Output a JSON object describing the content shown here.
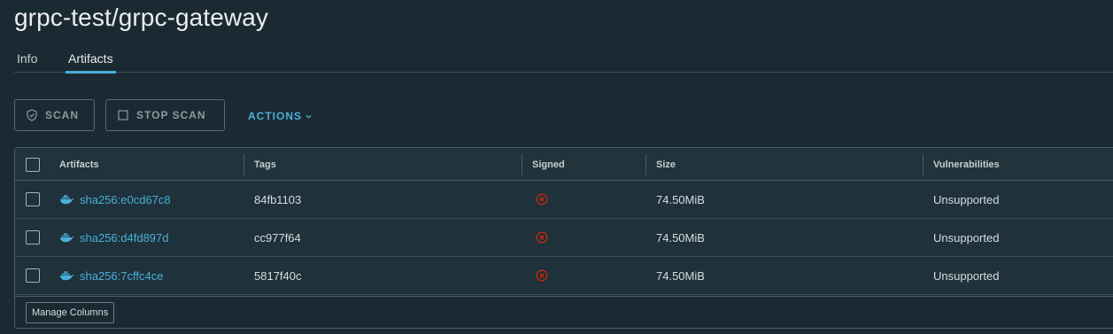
{
  "page": {
    "title": "grpc-test/grpc-gateway"
  },
  "tabs": [
    {
      "label": "Info"
    },
    {
      "label": "Artifacts"
    }
  ],
  "toolbar": {
    "scan_label": "SCAN",
    "stop_scan_label": "STOP SCAN",
    "actions_label": "ACTIONS"
  },
  "grid": {
    "columns": [
      "Artifacts",
      "Tags",
      "Signed",
      "Size",
      "Vulnerabilities"
    ],
    "rows": [
      {
        "digest": "sha256:e0cd67c8",
        "tag": "84fb1103",
        "signed": "unsigned",
        "size": "74.50MiB",
        "vulnerabilities": "Unsupported"
      },
      {
        "digest": "sha256:d4fd897d",
        "tag": "cc977f64",
        "signed": "unsigned",
        "size": "74.50MiB",
        "vulnerabilities": "Unsupported"
      },
      {
        "digest": "sha256:7cffc4ce",
        "tag": "5817f40c",
        "signed": "unsigned",
        "size": "74.50MiB",
        "vulnerabilities": "Unsupported"
      }
    ],
    "manage_columns_label": "Manage Columns"
  },
  "colors": {
    "background": "#1b2a32",
    "accent": "#49afd9",
    "error": "#e62700"
  },
  "icons": {
    "scan": "shield-icon",
    "stop": "square-icon",
    "actions": "chevron-down-icon",
    "artifact": "docker-icon",
    "signed": "error-circle-icon"
  }
}
